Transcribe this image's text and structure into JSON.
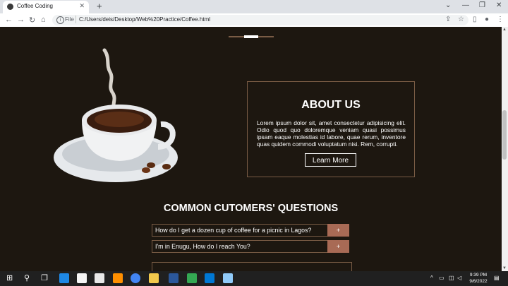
{
  "browser": {
    "tab_title": "Coffee Coding",
    "new_tab_symbol": "+",
    "close_symbol": "✕",
    "scheme": "File",
    "url": "C:/Users/deis/Desktop/Web%20Practice/Coffee.html",
    "window": {
      "minimize": "—",
      "restore": "❐",
      "close": "✕",
      "dropdown": "⌄"
    },
    "nav": {
      "back": "←",
      "forward": "→",
      "reload": "↻",
      "home": "⌂"
    }
  },
  "about": {
    "title": "ABOUT US",
    "text": "Lorem ipsum dolor sit, amet consectetur adipisicing elit. Odio quod quo doloremque veniam quasi possimus ipsam eaque molestias id labore, quae rerum, inventore quas quidem commodi voluptatum nisi. Rem, corrupti.",
    "button": "Learn More"
  },
  "faq": {
    "title": "COMMON CUTOMERS' QUESTIONS",
    "items": [
      {
        "question": "How do I get a dozen cup of coffee for a picnic in Lagos?",
        "toggle": "+"
      },
      {
        "question": "I'm in Enugu, How do I reach You?",
        "toggle": "+"
      }
    ]
  },
  "taskbar": {
    "time": "9:39 PM",
    "date": "9/6/2022"
  },
  "colors": {
    "page_bg": "#1d1710",
    "border": "#7a5c45",
    "accent": "#a86a55"
  }
}
